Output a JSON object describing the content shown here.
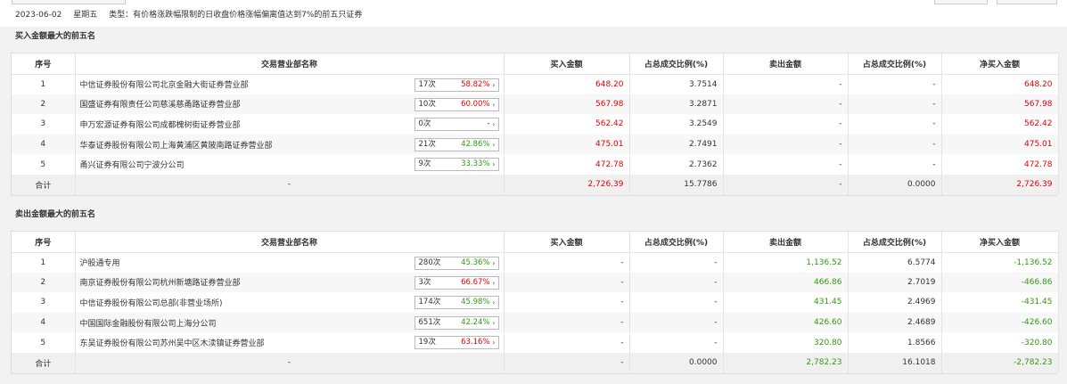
{
  "header": {
    "date": "2023-06-02",
    "weekday": "星期五",
    "type_text": "类型：有价格涨跌幅限制的日收盘价格涨幅偏离值达到7%的前五只证券"
  },
  "colors": {
    "up": "#e30000",
    "down": "#2f9a10"
  },
  "columns": [
    "序号",
    "交易营业部名称",
    "买入金额",
    "占总成交比例(%)",
    "卖出金额",
    "占总成交比例(%)",
    "净买入金额"
  ],
  "buy": {
    "title": "买入金额最大的前五名",
    "rows": [
      {
        "no": "1",
        "name": "中信证券股份有限公司北京金融大街证券营业部",
        "count": "17次",
        "pct": "58.82%",
        "pct_color": "red",
        "buy": "648.20",
        "buy_ratio": "3.7514",
        "sell": "-",
        "sell_ratio": "-",
        "net": "648.20"
      },
      {
        "no": "2",
        "name": "国盛证券有限责任公司慈溪慈甬路证券营业部",
        "count": "10次",
        "pct": "60.00%",
        "pct_color": "red",
        "buy": "567.98",
        "buy_ratio": "3.2871",
        "sell": "-",
        "sell_ratio": "-",
        "net": "567.98"
      },
      {
        "no": "3",
        "name": "申万宏源证券有限公司成都槐树街证券营业部",
        "count": "0次",
        "pct": "-",
        "pct_color": "dash",
        "buy": "562.42",
        "buy_ratio": "3.2549",
        "sell": "-",
        "sell_ratio": "-",
        "net": "562.42"
      },
      {
        "no": "4",
        "name": "华泰证券股份有限公司上海黄浦区黄陂南路证券营业部",
        "count": "21次",
        "pct": "42.86%",
        "pct_color": "green",
        "buy": "475.01",
        "buy_ratio": "2.7491",
        "sell": "-",
        "sell_ratio": "-",
        "net": "475.01"
      },
      {
        "no": "5",
        "name": "甬兴证券有限公司宁波分公司",
        "count": "9次",
        "pct": "33.33%",
        "pct_color": "green",
        "buy": "472.78",
        "buy_ratio": "2.7362",
        "sell": "-",
        "sell_ratio": "-",
        "net": "472.78"
      }
    ],
    "total": {
      "label": "合计",
      "name": "-",
      "buy": "2,726.39",
      "buy_ratio": "15.7786",
      "sell": "-",
      "sell_ratio": "0.0000",
      "net": "2,726.39"
    }
  },
  "sell": {
    "title": "卖出金额最大的前五名",
    "rows": [
      {
        "no": "1",
        "name": "沪股通专用",
        "count": "280次",
        "pct": "45.36%",
        "pct_color": "green",
        "buy": "-",
        "buy_ratio": "-",
        "sell": "1,136.52",
        "sell_ratio": "6.5774",
        "net": "-1,136.52"
      },
      {
        "no": "2",
        "name": "南京证券股份有限公司杭州新塘路证券营业部",
        "count": "3次",
        "pct": "66.67%",
        "pct_color": "red",
        "buy": "-",
        "buy_ratio": "-",
        "sell": "466.86",
        "sell_ratio": "2.7019",
        "net": "-466.86"
      },
      {
        "no": "3",
        "name": "中信证券股份有限公司总部(非营业场所)",
        "count": "174次",
        "pct": "45.98%",
        "pct_color": "green",
        "buy": "-",
        "buy_ratio": "-",
        "sell": "431.45",
        "sell_ratio": "2.4969",
        "net": "-431.45"
      },
      {
        "no": "4",
        "name": "中国国际金融股份有限公司上海分公司",
        "count": "651次",
        "pct": "42.24%",
        "pct_color": "green",
        "buy": "-",
        "buy_ratio": "-",
        "sell": "426.60",
        "sell_ratio": "2.4689",
        "net": "-426.60"
      },
      {
        "no": "5",
        "name": "东吴证券股份有限公司苏州吴中区木渎镇证券营业部",
        "count": "19次",
        "pct": "63.16%",
        "pct_color": "red",
        "buy": "-",
        "buy_ratio": "-",
        "sell": "320.80",
        "sell_ratio": "1.8566",
        "net": "-320.80"
      }
    ],
    "total": {
      "label": "合计",
      "name": "-",
      "buy": "-",
      "buy_ratio": "0.0000",
      "sell": "2,782.23",
      "sell_ratio": "16.1018",
      "net": "-2,782.23"
    }
  }
}
